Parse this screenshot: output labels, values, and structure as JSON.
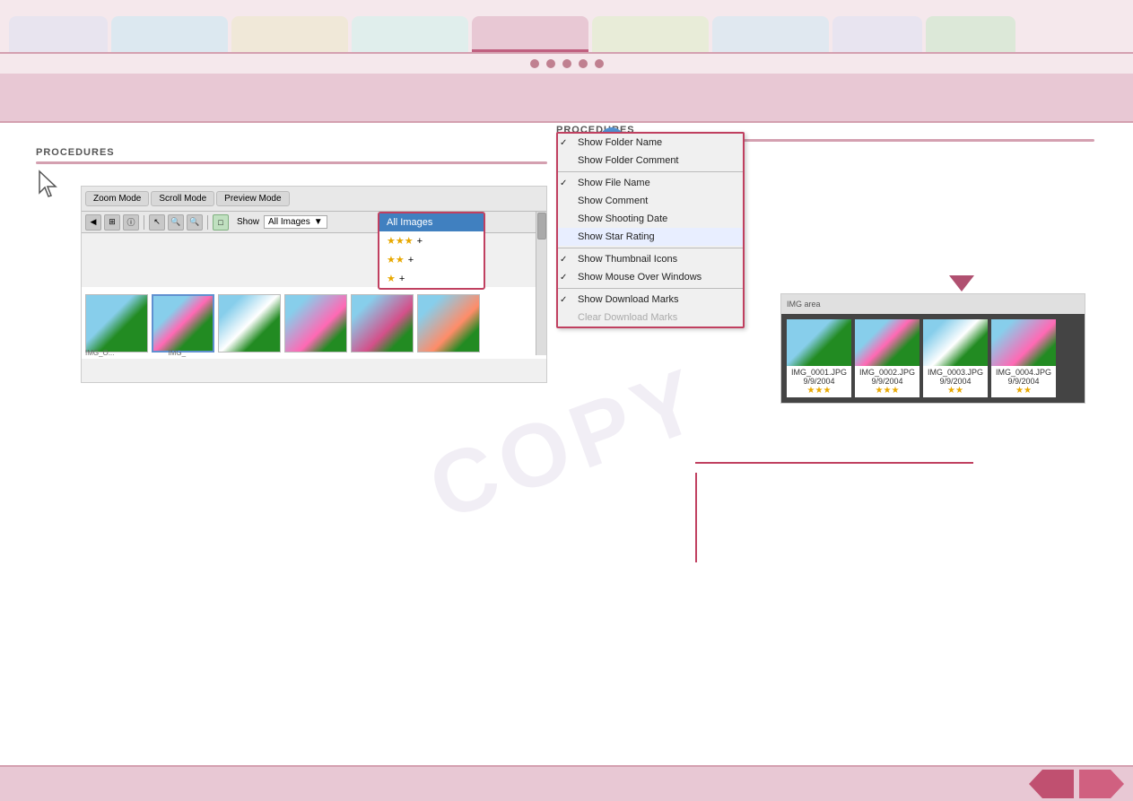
{
  "tabs": [
    {
      "label": "",
      "style": "tab-1"
    },
    {
      "label": "",
      "style": "tab-2"
    },
    {
      "label": "",
      "style": "tab-3"
    },
    {
      "label": "",
      "style": "tab-4"
    },
    {
      "label": "",
      "style": "tab-5"
    },
    {
      "label": "",
      "style": "tab-6"
    },
    {
      "label": "",
      "style": "tab-7"
    },
    {
      "label": "",
      "style": "tab-8"
    },
    {
      "label": "",
      "style": "tab-9"
    }
  ],
  "dots": [
    "•",
    "•",
    "•",
    "•",
    "•"
  ],
  "procedures_left": {
    "label": "PROCEDURES"
  },
  "procedures_right": {
    "label": "PROCEDURES"
  },
  "app": {
    "mode_buttons": [
      "Zoom Mode",
      "Scroll Mode",
      "Preview Mode"
    ],
    "show_label": "Show",
    "filter_dropdown": {
      "selected": "All Images",
      "options": [
        {
          "label": "All Images",
          "stars": ""
        },
        {
          "label": "★★★ +",
          "stars": "★★★+"
        },
        {
          "label": "★★ +",
          "stars": "★★+"
        },
        {
          "label": "★ +",
          "stars": "★+"
        }
      ]
    }
  },
  "context_menu": {
    "items": [
      {
        "label": "Show Folder Name",
        "checked": true
      },
      {
        "label": "Show Folder Comment",
        "checked": false
      },
      {
        "label": "Show File Name",
        "checked": true
      },
      {
        "label": "Show Comment",
        "checked": false
      },
      {
        "label": "Show Shooting Date",
        "checked": false
      },
      {
        "label": "Show Star Rating",
        "checked": false,
        "highlight": true
      },
      {
        "label": "Show Thumbnail Icons",
        "checked": true
      },
      {
        "label": "Show Mouse Over Windows",
        "checked": true
      },
      {
        "label": "Show Download Marks",
        "checked": true
      },
      {
        "label": "Clear Download Marks",
        "checked": false,
        "grayed": true
      }
    ]
  },
  "gallery": {
    "images": [
      {
        "filename": "IMG_0001.JPG",
        "date": "9/9/2004",
        "stars": "★★★"
      },
      {
        "filename": "IMG_0002.JPG",
        "date": "9/9/2004",
        "stars": "★★★"
      },
      {
        "filename": "IMG_0003.JPG",
        "date": "9/9/2004",
        "stars": "★★"
      },
      {
        "filename": "IMG_0004.JPG",
        "date": "9/9/2004",
        "stars": "★★"
      }
    ]
  },
  "watermark": "COPY",
  "bottom": {
    "prev_label": "",
    "next_label": ""
  }
}
